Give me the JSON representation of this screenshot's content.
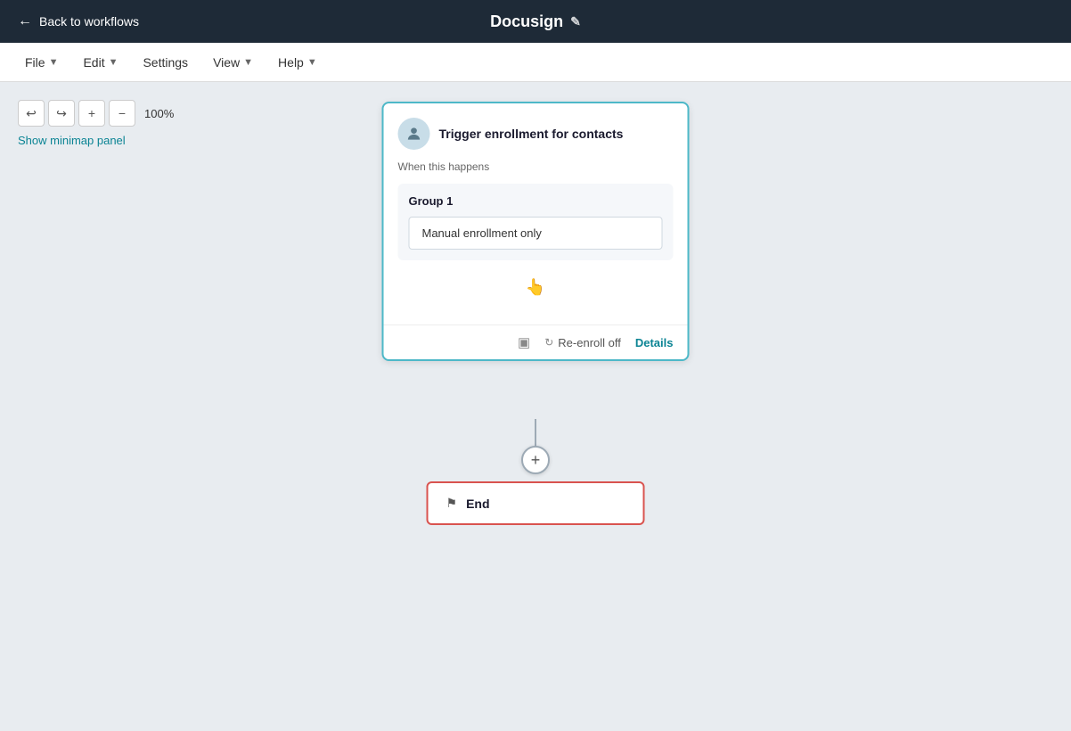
{
  "topbar": {
    "back_label": "Back to workflows",
    "title": "Docusign",
    "edit_icon": "✏️"
  },
  "menubar": {
    "items": [
      {
        "label": "File",
        "has_chevron": true
      },
      {
        "label": "Edit",
        "has_chevron": true
      },
      {
        "label": "Settings",
        "has_chevron": false
      },
      {
        "label": "View",
        "has_chevron": true
      },
      {
        "label": "Help",
        "has_chevron": true
      }
    ]
  },
  "canvas_toolbar": {
    "undo_label": "↩",
    "redo_label": "↪",
    "zoom_in_label": "+",
    "zoom_out_label": "−",
    "zoom_level": "100%",
    "show_minimap_label": "Show minimap panel"
  },
  "workflow_card": {
    "icon_alt": "contact-person-icon",
    "title": "Trigger enrollment for contacts",
    "subtitle": "When this happens",
    "group_label": "Group 1",
    "enrollment_text": "Manual enrollment only",
    "re_enroll_label": "Re-enroll off",
    "details_label": "Details"
  },
  "plus_button": {
    "label": "+"
  },
  "end_card": {
    "label": "End"
  },
  "colors": {
    "accent_teal": "#0b8494",
    "card_border": "#4db8c8",
    "end_border": "#d9534f",
    "connector": "#9daab5"
  }
}
